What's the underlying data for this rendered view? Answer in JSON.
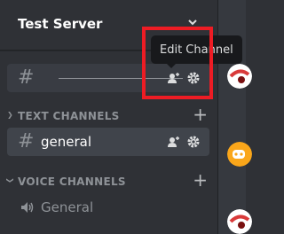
{
  "server": {
    "name": "Test Server"
  },
  "tooltip": {
    "text": "Edit Channel"
  },
  "channels": {
    "uncategorized": {
      "hash": "#"
    },
    "text_category": {
      "label": "TEXT CHANNELS"
    },
    "text_channels": [
      {
        "hash": "#",
        "name": "general"
      }
    ],
    "voice_category": {
      "label": "VOICE CHANNELS"
    },
    "voice_channels": [
      {
        "name": "General"
      }
    ]
  },
  "colors": {
    "sidebar_bg": "#2f3136",
    "main_bg": "#36393f",
    "annotation_red": "#ed1c24",
    "tooltip_bg": "#18191c"
  },
  "icons": {
    "create_invite": "person-add-icon",
    "settings": "gear-icon",
    "speaker": "speaker-icon"
  }
}
